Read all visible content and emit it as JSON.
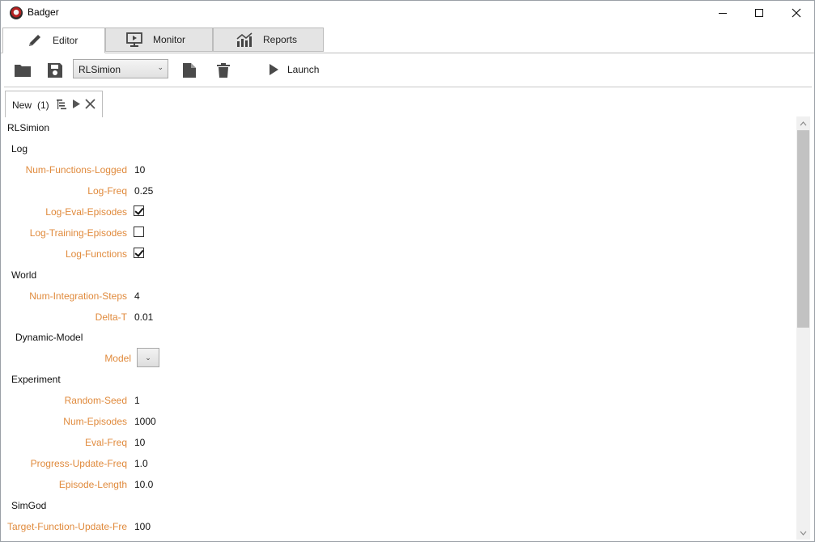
{
  "window": {
    "title": "Badger",
    "controls": {
      "minimize": "—",
      "maximize": "☐",
      "close": "✕"
    }
  },
  "main_tabs": [
    {
      "label": "Editor",
      "icon": "pencil-icon",
      "active": true
    },
    {
      "label": "Monitor",
      "icon": "monitor-icon",
      "active": false
    },
    {
      "label": "Reports",
      "icon": "chart-icon",
      "active": false
    }
  ],
  "toolbar": {
    "open_icon": "folder-icon",
    "save_icon": "save-icon",
    "app_select": {
      "value": "RLSimion",
      "caret": "⌄"
    },
    "new_icon": "new-file-icon",
    "delete_icon": "trash-icon",
    "launch_label": "Launch"
  },
  "doc_tab": {
    "label": "New",
    "count": "(1)"
  },
  "tree": {
    "root": "RLSimion",
    "sections": {
      "log": "Log",
      "world": "World",
      "dynamic_model": "Dynamic-Model",
      "experiment": "Experiment",
      "simgod": "SimGod"
    },
    "params": {
      "num_functions_logged": {
        "label": "Num-Functions-Logged",
        "value": "10"
      },
      "log_freq": {
        "label": "Log-Freq",
        "value": "0.25"
      },
      "log_eval_episodes": {
        "label": "Log-Eval-Episodes",
        "checked": true
      },
      "log_training_episodes": {
        "label": "Log-Training-Episodes",
        "checked": false
      },
      "log_functions": {
        "label": "Log-Functions",
        "checked": true
      },
      "num_integration_steps": {
        "label": "Num-Integration-Steps",
        "value": "4"
      },
      "delta_t": {
        "label": "Delta-T",
        "value": "0.01"
      },
      "model": {
        "label": "Model",
        "caret": "⌄"
      },
      "random_seed": {
        "label": "Random-Seed",
        "value": "1"
      },
      "num_episodes": {
        "label": "Num-Episodes",
        "value": "1000"
      },
      "eval_freq": {
        "label": "Eval-Freq",
        "value": "10"
      },
      "progress_update_freq": {
        "label": "Progress-Update-Freq",
        "value": "1.0"
      },
      "episode_length": {
        "label": "Episode-Length",
        "value": "10.0"
      },
      "target_function_update_freq": {
        "label": "Target-Function-Update-Fre",
        "value": "100"
      }
    }
  },
  "colors": {
    "param_label": "#e08a3c",
    "tab_inactive": "#e4e4e4",
    "scroll_thumb": "#c2c2c2"
  }
}
